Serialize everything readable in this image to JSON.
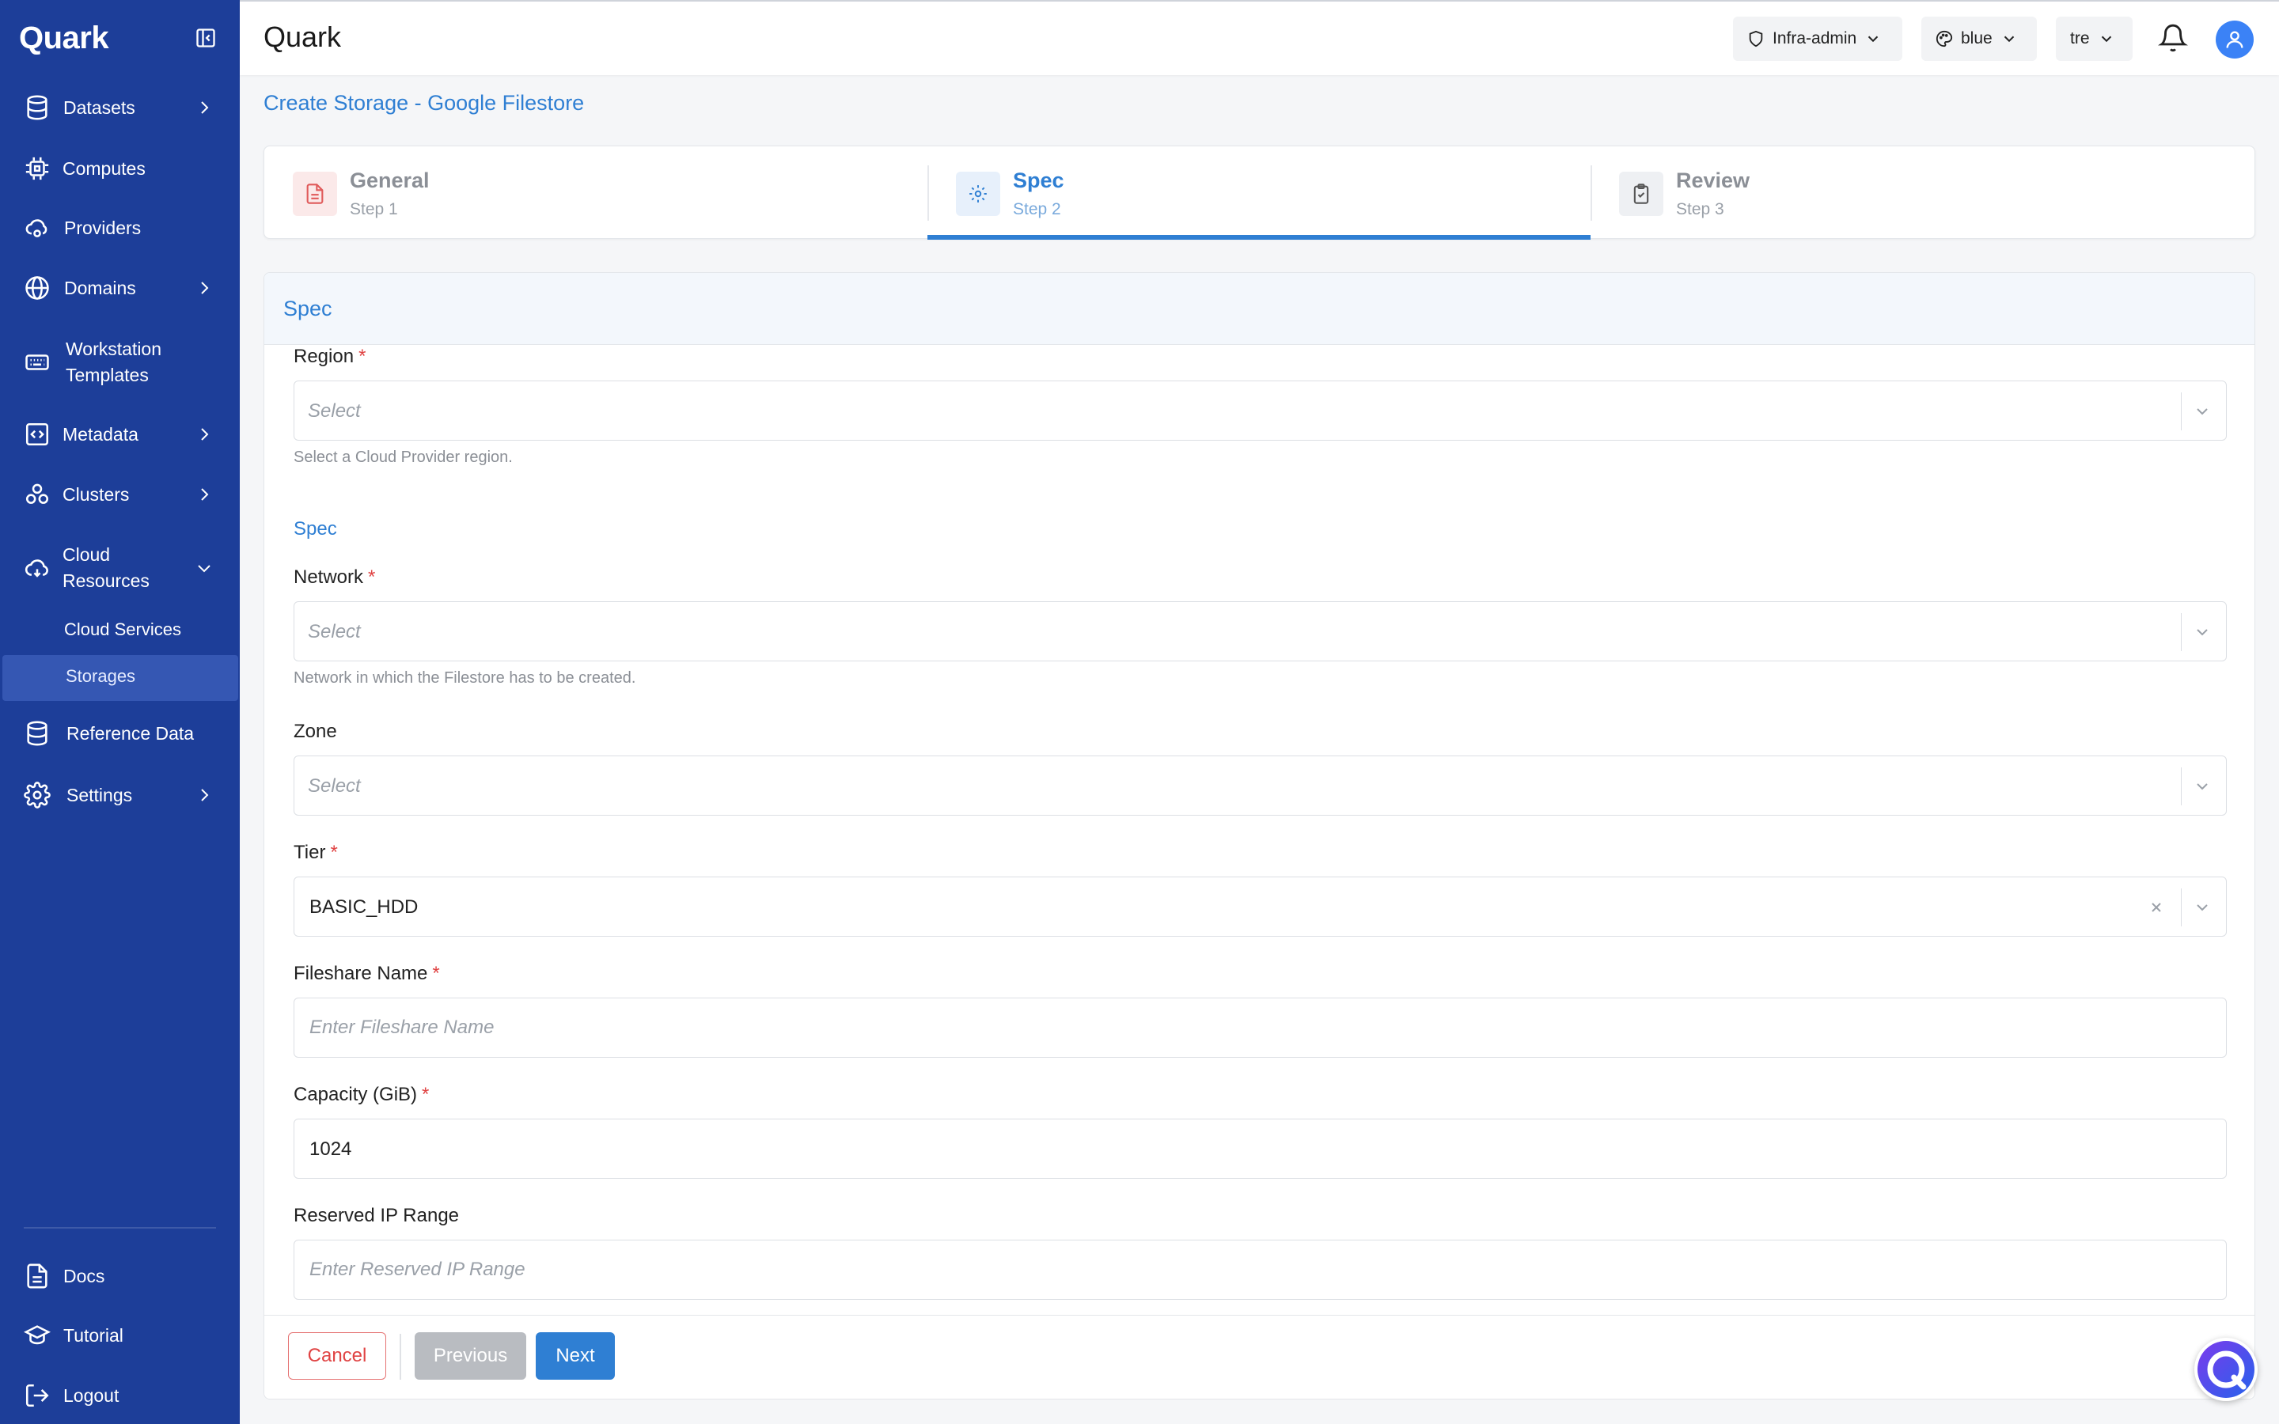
{
  "app": {
    "brand": "Quark",
    "title": "Quark"
  },
  "sidebar": {
    "items": [
      {
        "label": "Datasets",
        "icon": "database-icon"
      },
      {
        "label": "Computes",
        "icon": "cpu-icon"
      },
      {
        "label": "Providers",
        "icon": "cloud-provider-icon"
      },
      {
        "label": "Domains",
        "icon": "globe-icon"
      },
      {
        "label": "Workstation",
        "label2": "Templates",
        "icon": "keyboard-icon"
      },
      {
        "label": "Metadata",
        "icon": "code-icon"
      },
      {
        "label": "Clusters",
        "icon": "cluster-icon"
      },
      {
        "label": "Cloud",
        "label2": "Resources",
        "icon": "cloud-icon"
      },
      {
        "label": "Reference Data",
        "icon": "database-icon"
      },
      {
        "label": "Settings",
        "icon": "gear-icon"
      }
    ],
    "sub_items": [
      {
        "label": "Cloud Services"
      },
      {
        "label": "Storages"
      }
    ],
    "bottom": [
      {
        "label": "Docs",
        "icon": "document-icon"
      },
      {
        "label": "Tutorial",
        "icon": "graduation-cap-icon"
      },
      {
        "label": "Logout",
        "icon": "logout-icon"
      }
    ]
  },
  "header": {
    "role": "Infra-admin",
    "theme": "blue",
    "tenant": "tre"
  },
  "page": {
    "title": "Create Storage - Google Filestore"
  },
  "stepper": {
    "steps": [
      {
        "name": "General",
        "sub": "Step 1"
      },
      {
        "name": "Spec",
        "sub": "Step 2"
      },
      {
        "name": "Review",
        "sub": "Step 3"
      }
    ],
    "active": 2
  },
  "form": {
    "section": "Spec",
    "subsection": "Spec",
    "region": {
      "label": "Region",
      "placeholder": "Select",
      "help": "Select a Cloud Provider region."
    },
    "network": {
      "label": "Network",
      "placeholder": "Select",
      "help": "Network in which the Filestore has to be created."
    },
    "zone": {
      "label": "Zone",
      "placeholder": "Select"
    },
    "tier": {
      "label": "Tier",
      "value": "BASIC_HDD"
    },
    "fileshare": {
      "label": "Fileshare Name",
      "placeholder": "Enter Fileshare Name"
    },
    "capacity": {
      "label": "Capacity (GiB)",
      "value": "1024"
    },
    "reserved_ip": {
      "label": "Reserved IP Range",
      "placeholder": "Enter Reserved IP Range"
    }
  },
  "footer": {
    "cancel": "Cancel",
    "previous": "Previous",
    "next": "Next"
  },
  "colors": {
    "sidebar": "#1d3e99",
    "accent": "#2f7fd3",
    "required": "#e04343"
  }
}
